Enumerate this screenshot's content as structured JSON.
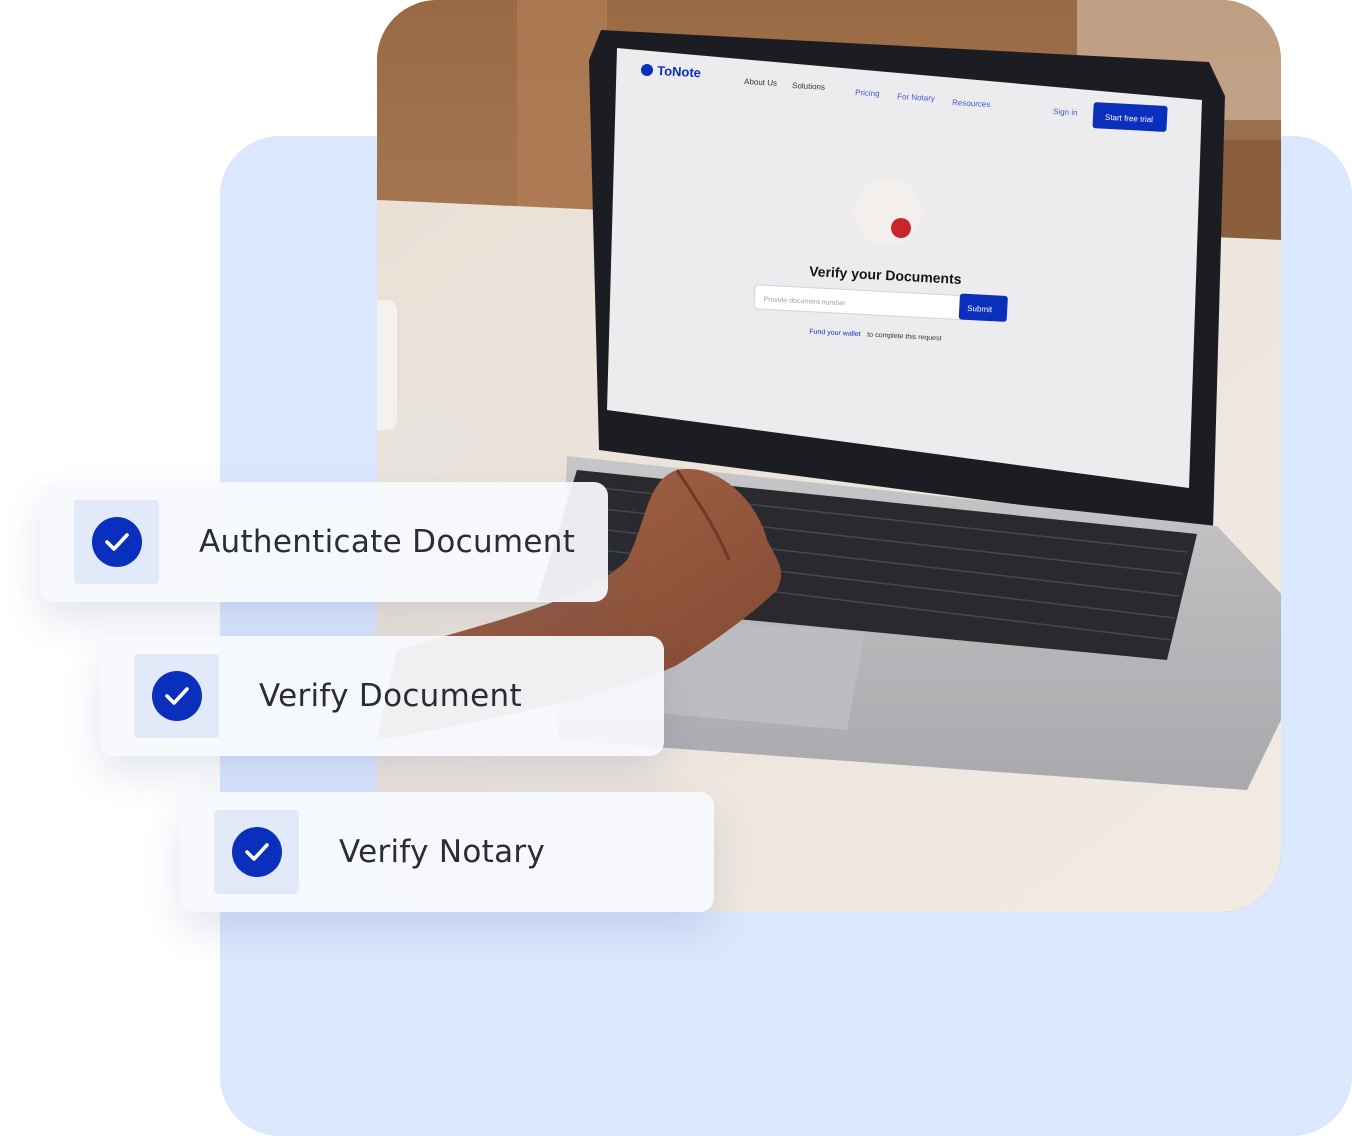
{
  "screen": {
    "brand": "ToNote",
    "nav": [
      "About Us",
      "Solutions",
      "Pricing",
      "For Notary",
      "Resources"
    ],
    "sign_in": "Sign in",
    "cta": "Start free trial",
    "heading": "Verify your Documents",
    "input_placeholder": "Provide document number",
    "submit": "Submit",
    "fund_link": "Fund your wallet",
    "fund_rest": "to complete this request"
  },
  "features": [
    {
      "label": "Authenticate Document",
      "icon": "check-icon"
    },
    {
      "label": "Verify Document",
      "icon": "check-icon"
    },
    {
      "label": "Verify Notary",
      "icon": "check-icon"
    }
  ],
  "colors": {
    "accent": "#0a2fbd",
    "backdrop": "#dbe7fd",
    "card": "#f7f9fd",
    "tile": "#e2e9f8",
    "text": "#2c2c34"
  }
}
